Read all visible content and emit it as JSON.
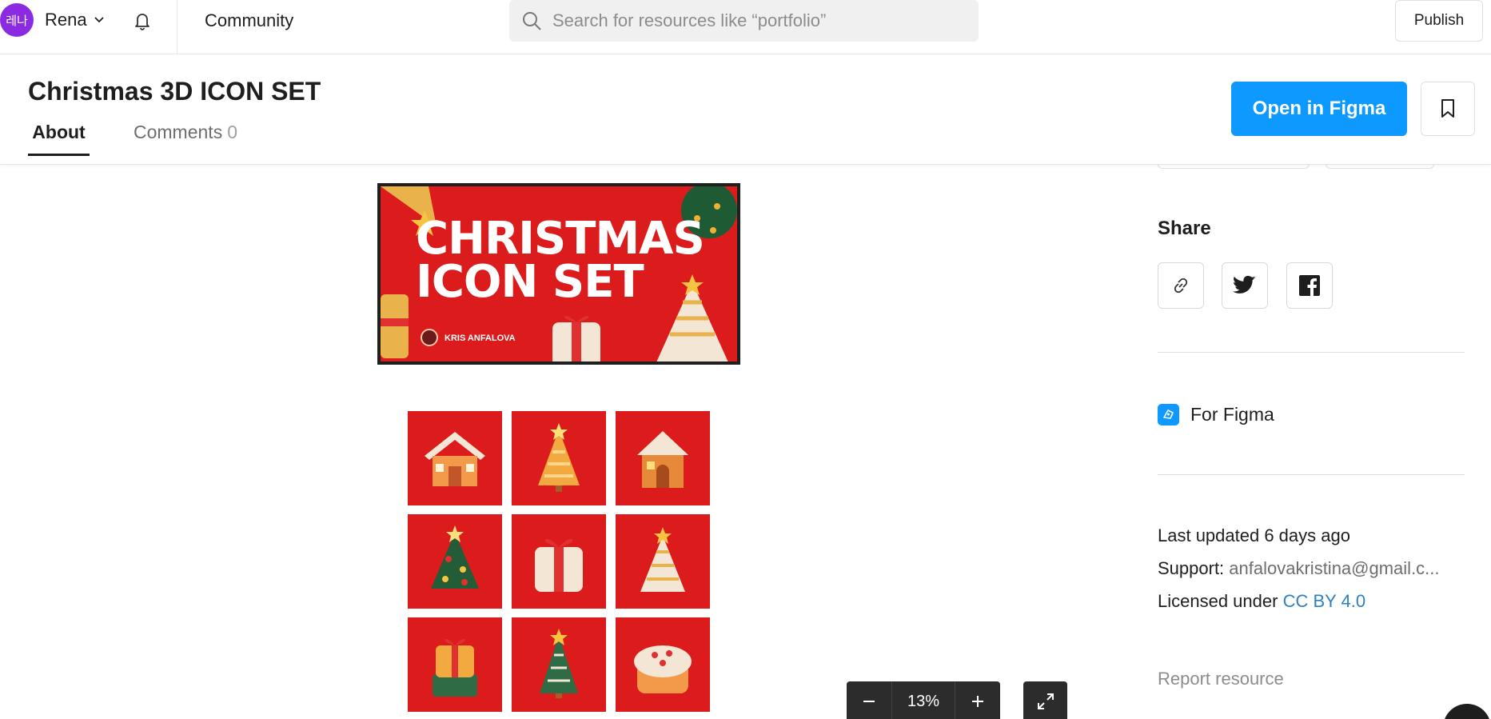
{
  "topbar": {
    "avatar_text": "레나",
    "user_name": "Rena",
    "nav_label": "Community",
    "search_placeholder": "Search for resources like “portfolio”",
    "publish_label": "Publish"
  },
  "header": {
    "title": "Christmas 3D ICON SET",
    "tabs": [
      {
        "label": "About",
        "active": true
      },
      {
        "label": "Comments",
        "count": "0"
      }
    ],
    "open_label": "Open in Figma"
  },
  "preview": {
    "banner_line1": "CHRISTMAS",
    "banner_line2": "ICON SET",
    "banner_author": "KRIS ANFALOVA",
    "icons": [
      "house-icon",
      "golden-tree-icon",
      "gingerbread-house-icon",
      "christmas-tree-icon",
      "gift-box-icon",
      "cone-tree-icon",
      "gift-chest-icon",
      "green-tree-icon",
      "cake-icon"
    ]
  },
  "sidebar": {
    "share_title": "Share",
    "share_buttons": [
      "link-icon",
      "twitter-icon",
      "facebook-icon"
    ],
    "platform": "For Figma",
    "last_updated": "Last updated 6 days ago",
    "support_label": "Support:",
    "support_value": "anfalovakristina@gmail.c...",
    "license_label": "Licensed under",
    "license_value": "CC BY 4.0",
    "report_label": "Report resource"
  },
  "zoom": {
    "value": "13%"
  },
  "colors": {
    "accent": "#0d99ff",
    "banner_red": "#dc1c1c",
    "avatar": "#8a2be2",
    "link": "#2f7fc1"
  }
}
